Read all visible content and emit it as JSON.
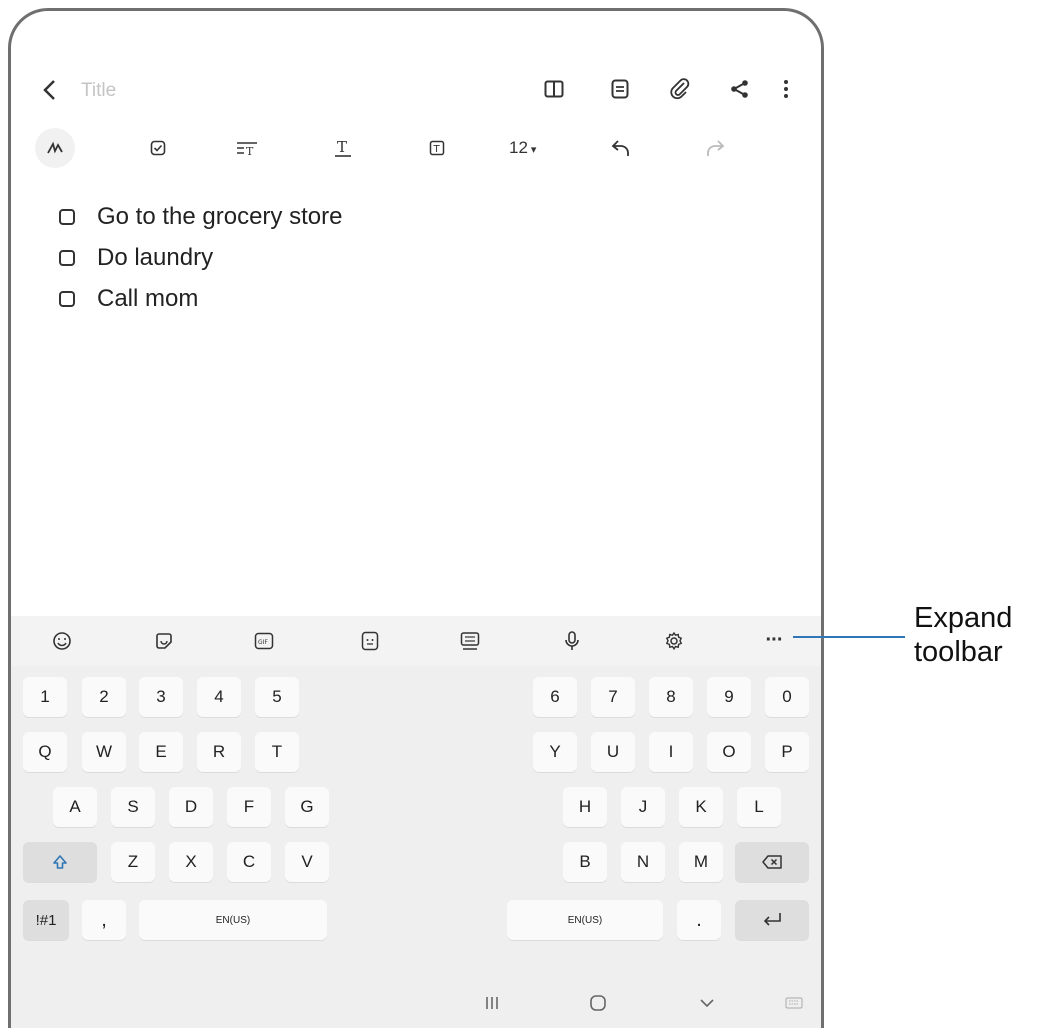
{
  "note": {
    "title_placeholder": "Title",
    "items": [
      "Go to the grocery store",
      "Do laundry",
      "Call mom"
    ]
  },
  "format": {
    "font_size": "12",
    "font_size_arrow": "▾"
  },
  "keyboard": {
    "row1_left": [
      "1",
      "2",
      "3",
      "4",
      "5"
    ],
    "row1_right": [
      "6",
      "7",
      "8",
      "9",
      "0"
    ],
    "row2_left": [
      "Q",
      "W",
      "E",
      "R",
      "T"
    ],
    "row2_right": [
      "Y",
      "U",
      "I",
      "O",
      "P"
    ],
    "row3_left": [
      "A",
      "S",
      "D",
      "F",
      "G"
    ],
    "row3_right": [
      "H",
      "J",
      "K",
      "L"
    ],
    "row4_left": [
      "Z",
      "X",
      "C",
      "V"
    ],
    "row4_right": [
      "B",
      "N",
      "M"
    ],
    "symbols": "!#1",
    "comma": ",",
    "space_left": "EN(US)",
    "space_right": "EN(US)",
    "period": ".",
    "toolbar_more": "···"
  },
  "callout": {
    "line1": "Expand",
    "line2": "toolbar"
  },
  "colors": {
    "callout_line": "#2f76b6",
    "shift": "#2f76b6"
  }
}
